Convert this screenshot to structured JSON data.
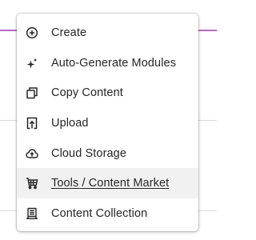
{
  "menu": {
    "items": [
      {
        "label": "Create",
        "icon": "plus-circle-icon"
      },
      {
        "label": "Auto-Generate Modules",
        "icon": "sparkle-icon"
      },
      {
        "label": "Copy Content",
        "icon": "copy-icon"
      },
      {
        "label": "Upload",
        "icon": "upload-icon"
      },
      {
        "label": "Cloud Storage",
        "icon": "cloud-upload-icon"
      },
      {
        "label": "Tools / Content Market",
        "icon": "cart-icon",
        "active": true
      },
      {
        "label": "Content Collection",
        "icon": "content-collection-icon"
      }
    ]
  },
  "colors": {
    "accent_line": "#b86ac9",
    "text": "#262626",
    "hover_bg": "#f1f1f1"
  }
}
